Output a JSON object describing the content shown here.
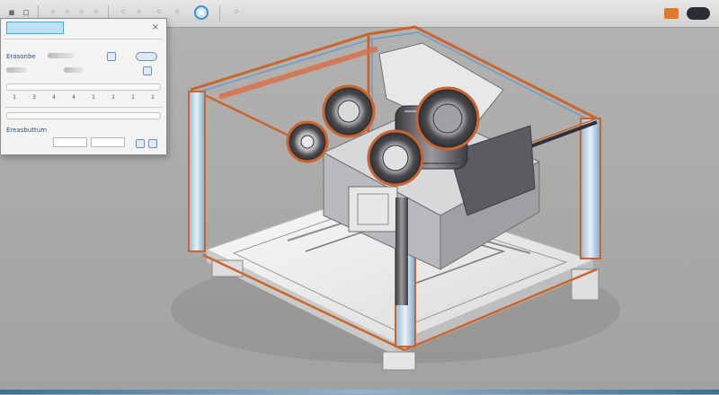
{
  "toolbar": {
    "tools": [
      "tool-a",
      "tool-b",
      "tool-c",
      "tool-d",
      "tool-e",
      "tool-f",
      "tool-g",
      "tool-h"
    ],
    "right_icons": [
      "render-icon",
      "view-toggle-icon"
    ]
  },
  "panel": {
    "title": "",
    "rows": [
      {
        "label": "Erasonbe",
        "value": ""
      },
      {
        "label": "Ereasbuttum",
        "value": ""
      }
    ],
    "ticks": [
      "1",
      "3",
      "4",
      "4",
      "1",
      "1",
      "1",
      "1"
    ],
    "inputs": [
      "",
      ""
    ]
  },
  "scene": {
    "colors": {
      "frame_orange": "#c9652e",
      "frame_blue": "#6a9cc8",
      "base_white": "#f2f2f0",
      "metal_dark": "#4f4f52",
      "glass": "#d3d6da"
    }
  }
}
